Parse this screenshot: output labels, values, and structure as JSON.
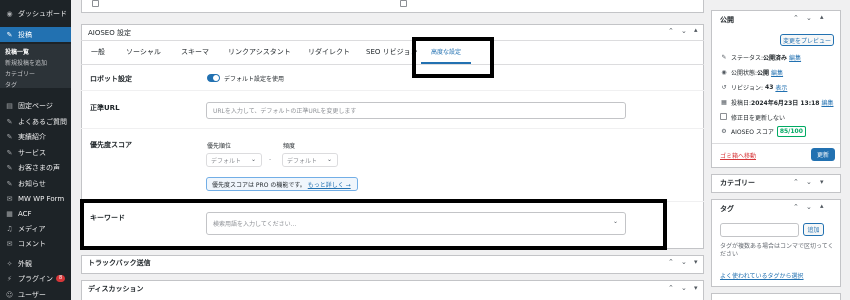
{
  "sidebar": {
    "items": [
      {
        "icon": "dashboard-icon",
        "glyph": "◉",
        "label": "ダッシュボード"
      },
      {
        "icon": "pin-icon",
        "glyph": "✎",
        "label": "投稿"
      },
      {
        "icon": "page-icon",
        "glyph": "▤",
        "label": "固定ページ"
      },
      {
        "icon": "pin-icon",
        "glyph": "✎",
        "label": "よくあるご質問"
      },
      {
        "icon": "pin-icon",
        "glyph": "✎",
        "label": "実績紹介"
      },
      {
        "icon": "pin-icon",
        "glyph": "✎",
        "label": "サービス"
      },
      {
        "icon": "pin-icon",
        "glyph": "✎",
        "label": "お客さまの声"
      },
      {
        "icon": "pin-icon",
        "glyph": "✎",
        "label": "お知らせ"
      },
      {
        "icon": "form-icon",
        "glyph": "✉",
        "label": "MW WP Form"
      },
      {
        "icon": "grid-icon",
        "glyph": "▦",
        "label": "ACF"
      },
      {
        "icon": "media-icon",
        "glyph": "♫",
        "label": "メディア"
      },
      {
        "icon": "comment-icon",
        "glyph": "✉",
        "label": "コメント"
      },
      {
        "icon": "appearance-icon",
        "glyph": "✧",
        "label": "外観"
      },
      {
        "icon": "plugin-icon",
        "glyph": "⚡",
        "label": "プラグイン",
        "badge": "8"
      },
      {
        "icon": "user-icon",
        "glyph": "☺",
        "label": "ユーザー"
      }
    ],
    "submenu": [
      "投稿一覧",
      "新規投稿を追加",
      "カテゴリー",
      "タグ"
    ]
  },
  "aioseo": {
    "title": "AIOSEO 設定",
    "tabs": [
      "一般",
      "ソーシャル",
      "スキーマ",
      "リンクアシスタント",
      "リダイレクト",
      "SEO リビジョン",
      "高度な設定"
    ],
    "robots": {
      "label": "ロボット設定",
      "toggle_label": "デフォルト設定を使用",
      "toggle_on": true
    },
    "canonical": {
      "label": "正準URL",
      "placeholder": "URLを入力して、デフォルトの正準URLを変更します"
    },
    "priority": {
      "label": "優先度スコア",
      "priority_label": "優先順位",
      "frequency_label": "頻度",
      "priority_value": "デフォルト",
      "frequency_value": "デフォルト",
      "separator": "-",
      "notice": "優先度スコアは PRO の機能です。",
      "notice_link": "もっと詳しく →"
    },
    "keywords": {
      "label": "キーワード",
      "placeholder": "検索用語を入力してください..."
    }
  },
  "trackback": {
    "title": "トラックバック送信"
  },
  "discussion": {
    "title": "ディスカッション"
  },
  "publish": {
    "title": "公開",
    "preview_button": "変更をプレビュー",
    "status_label": "ステータス:",
    "status_value": "公開済み",
    "status_edit": "編集",
    "visibility_label": "公開状態:",
    "visibility_value": "公開",
    "visibility_edit": "編集",
    "revisions_label": "リビジョン:",
    "revisions_value": "43",
    "revisions_link": "表示",
    "date_label": "投稿日:",
    "date_value": "2024年6月23日 13:18",
    "date_edit": "編集",
    "fix_date_label": "修正日を更新しない",
    "aioseo_score_label": "AIOSEO スコア",
    "aioseo_score_value": "85/100",
    "trash_link": "ゴミ箱へ移動",
    "update_button": "更新"
  },
  "category": {
    "title": "カテゴリー"
  },
  "tags": {
    "title": "タグ",
    "add_button": "追加",
    "help_text": "タグが複数ある場合はコンマで区切ってください",
    "popular_link": "よく使われているタグから選択"
  },
  "colors": {
    "accent": "#2271b1",
    "sidebar": "#1d2327",
    "score": "#00aa63",
    "danger": "#d63638"
  }
}
